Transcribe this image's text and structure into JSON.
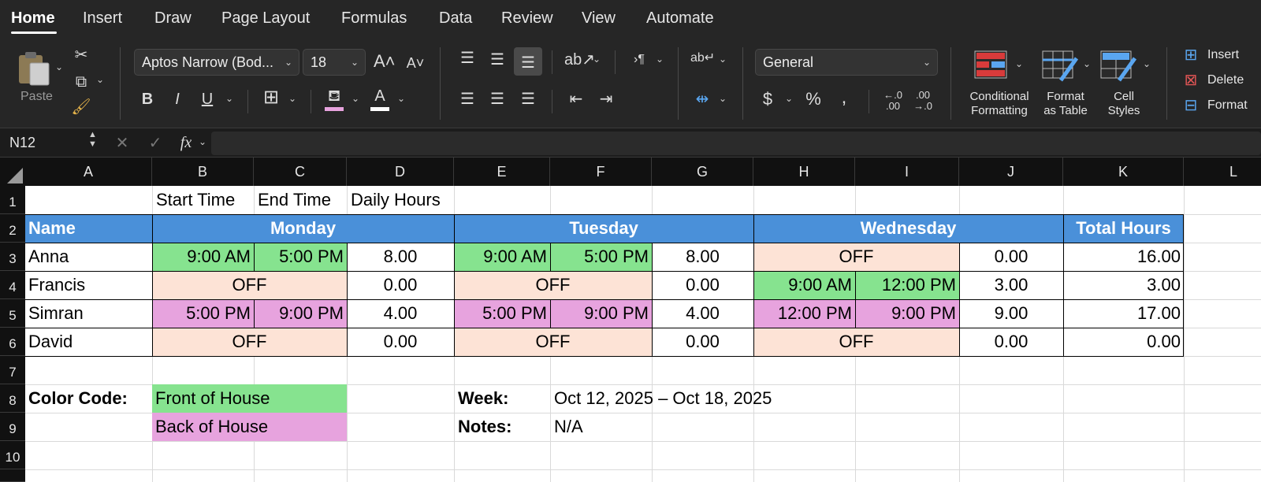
{
  "ribbon": {
    "tabs": [
      "Home",
      "Insert",
      "Draw",
      "Page Layout",
      "Formulas",
      "Data",
      "Review",
      "View",
      "Automate"
    ],
    "paste_label": "Paste",
    "font_name": "Aptos Narrow (Bod...",
    "font_size": "18",
    "number_format": "General",
    "conditional_formatting_l1": "Conditional",
    "conditional_formatting_l2": "Formatting",
    "format_table_l1": "Format",
    "format_table_l2": "as Table",
    "cell_styles_l1": "Cell",
    "cell_styles_l2": "Styles",
    "insert_label": "Insert",
    "delete_label": "Delete",
    "format_label": "Format",
    "colors": {
      "fill_swatch": "#e7a3de",
      "font_swatch": "#ffffff"
    }
  },
  "formula_bar": {
    "name_box": "N12",
    "fx": "fx",
    "value": ""
  },
  "grid": {
    "columns": [
      "A",
      "B",
      "C",
      "D",
      "E",
      "F",
      "G",
      "H",
      "I",
      "J",
      "K",
      "L"
    ],
    "rows": [
      "1",
      "2",
      "3",
      "4",
      "5",
      "6",
      "7",
      "8",
      "9",
      "10"
    ],
    "row1": {
      "start": "Start Time",
      "end": "End Time",
      "daily": "Daily Hours"
    },
    "header": {
      "name": "Name",
      "monday": "Monday",
      "tuesday": "Tuesday",
      "wednesday": "Wednesday",
      "total": "Total Hours"
    },
    "people": [
      {
        "name": "Anna",
        "mon": {
          "start": "9:00 AM",
          "end": "5:00 PM",
          "hours": "8.00"
        },
        "tue": {
          "start": "9:00 AM",
          "end": "5:00 PM",
          "hours": "8.00"
        },
        "wed": {
          "off": "OFF",
          "hours": "0.00"
        },
        "total": "16.00"
      },
      {
        "name": "Francis",
        "mon": {
          "off": "OFF",
          "hours": "0.00"
        },
        "tue": {
          "off": "OFF",
          "hours": "0.00"
        },
        "wed": {
          "start": "9:00 AM",
          "end": "12:00 PM",
          "hours": "3.00"
        },
        "total": "3.00"
      },
      {
        "name": "Simran",
        "mon": {
          "start": "5:00 PM",
          "end": "9:00 PM",
          "hours": "4.00"
        },
        "tue": {
          "start": "5:00 PM",
          "end": "9:00 PM",
          "hours": "4.00"
        },
        "wed": {
          "start": "12:00 PM",
          "end": "9:00 PM",
          "hours": "9.00"
        },
        "total": "17.00"
      },
      {
        "name": "David",
        "mon": {
          "off": "OFF",
          "hours": "0.00"
        },
        "tue": {
          "off": "OFF",
          "hours": "0.00"
        },
        "wed": {
          "off": "OFF",
          "hours": "0.00"
        },
        "total": "0.00"
      }
    ],
    "legend": {
      "label": "Color Code:",
      "foh": "Front of House",
      "boh": "Back of House"
    },
    "meta": {
      "week_label": "Week:",
      "week_value": "Oct 12, 2025 – Oct 18, 2025",
      "notes_label": "Notes:",
      "notes_value": "N/A"
    },
    "colors": {
      "header_blue": "#4a90d9",
      "front_green": "#86e38f",
      "back_pink": "#e7a3de",
      "off_peach": "#fde3d6"
    }
  }
}
